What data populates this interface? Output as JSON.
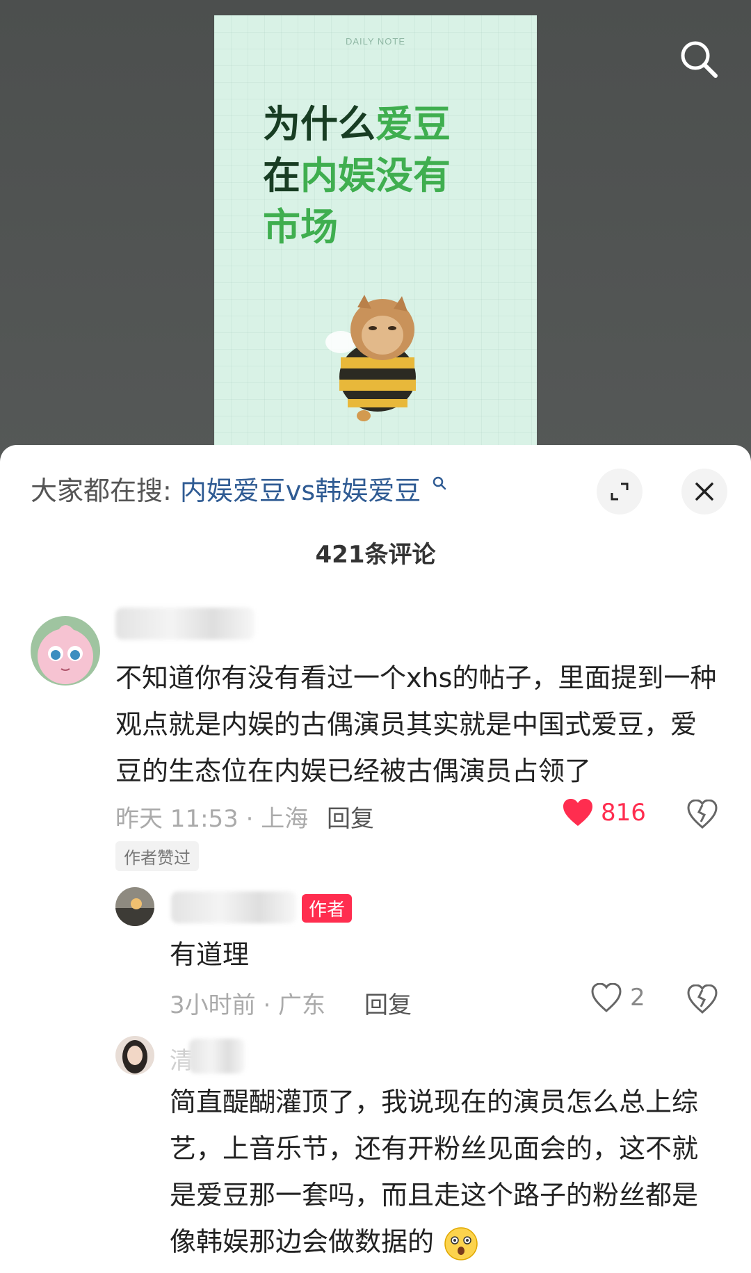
{
  "post": {
    "tag": "DAILY NOTE",
    "title_parts": [
      {
        "text": "为什么",
        "green": false
      },
      {
        "text": "爱豆",
        "green": true
      },
      {
        "text": "在",
        "green": false
      },
      {
        "text": "内娱没有",
        "green": true
      },
      {
        "text": "市场",
        "green": true
      }
    ]
  },
  "comments_panel": {
    "hot_search_prefix": "大家都在搜:",
    "hot_search_query": "内娱爱豆vs韩娱爱豆",
    "count_label": "421条评论"
  },
  "comments": [
    {
      "text": "不知道你有没有看过一个xhs的帖子，里面提到一种观点就是内娱的古偶演员其实就是中国式爱豆，爱豆的生态位在内娱已经被古偶演员占领了",
      "meta": "昨天 11:53 · 上海",
      "reply_label": "回复",
      "likes": "816",
      "liked_badge": "作者赞过"
    },
    {
      "author_badge": "作者",
      "text": "有道理",
      "meta": "3小时前 · 广东",
      "reply_label": "回复",
      "likes": "2"
    },
    {
      "name_visible": "清",
      "text": "简直醍醐灌顶了，我说现在的演员怎么总上综艺，上音乐节，还有开粉丝见面会的，这不就是爱豆那一套吗，而且走这个路子的粉丝都是像韩娱那边会做数据的"
    }
  ],
  "colors": {
    "accent_red": "#ff2d4f",
    "link_blue": "#2f5b93",
    "cover_green": "#3fae4f"
  }
}
